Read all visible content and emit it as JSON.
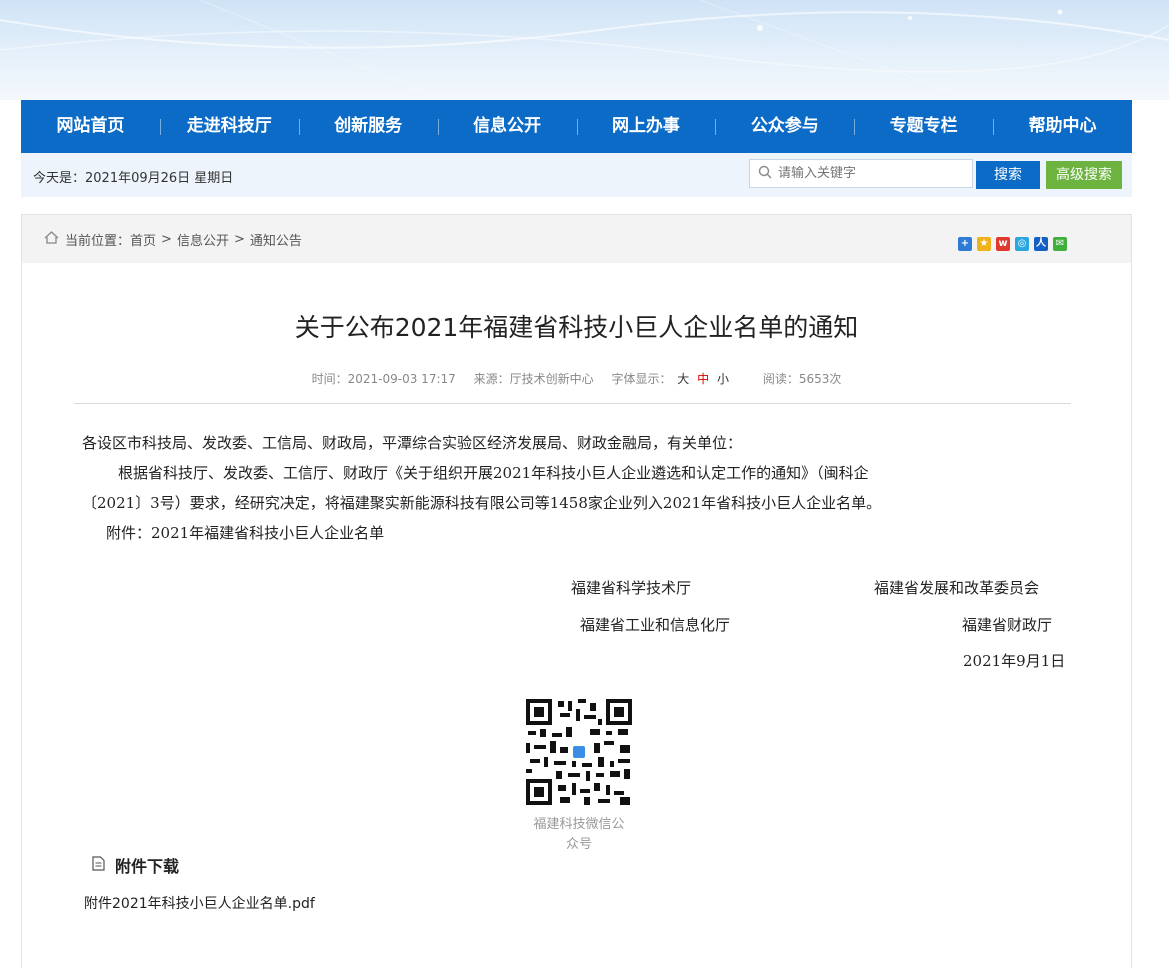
{
  "nav": {
    "items": [
      "网站首页",
      "走进科技厅",
      "创新服务",
      "信息公开",
      "网上办事",
      "公众参与",
      "专题专栏",
      "帮助中心"
    ],
    "color": "#0b6bc6"
  },
  "infobar": {
    "date_label": "今天是：2021年09月26日 星期日",
    "search_placeholder": "请输入关键字",
    "search_button": "搜索",
    "advanced_button": "高级搜索"
  },
  "breadcrumb": {
    "prefix": "当前位置：",
    "items": [
      "首页",
      "信息公开",
      "通知公告"
    ],
    "separator": ">"
  },
  "share_icons": [
    "plus-icon",
    "qzone-icon",
    "weibo-icon",
    "tencent-icon",
    "renren-icon",
    "wechat-icon"
  ],
  "article": {
    "title": "关于公布2021年福建省科技小巨人企业名单的通知",
    "meta": {
      "time_label": "时间：2021-09-03 17:17",
      "source_label": "来源：厅技术创新中心",
      "font_label": "字体显示：",
      "font_large": "大",
      "font_medium": "中",
      "font_small": "小",
      "reads_label": "阅读：5653次"
    },
    "paragraphs": [
      "各设区市科技局、发改委、工信局、财政局，平潭综合实验区经济发展局、财政金融局，有关单位：",
      "根据省科技厅、发改委、工信厅、财政厅《关于组织开展2021年科技小巨人企业遴选和认定工作的通知》（闽科企",
      "〔2021〕3号）要求，经研究决定，将福建聚实新能源科技有限公司等1458家企业列入2021年省科技小巨人企业名单。",
      "附件：2021年福建省科技小巨人企业名单"
    ],
    "signatures": {
      "s1": "福建省科学技术厅",
      "s2": "福建省发展和改革委员会",
      "s3": "福建省工业和信息化厅",
      "s4": "福建省财政厅",
      "date": "2021年9月1日"
    },
    "qr_caption_line1": "福建科技微信公",
    "qr_caption_line2": "众号"
  },
  "attachments": {
    "heading": "附件下载",
    "files": [
      "附件2021年科技小巨人企业名单.pdf"
    ]
  }
}
